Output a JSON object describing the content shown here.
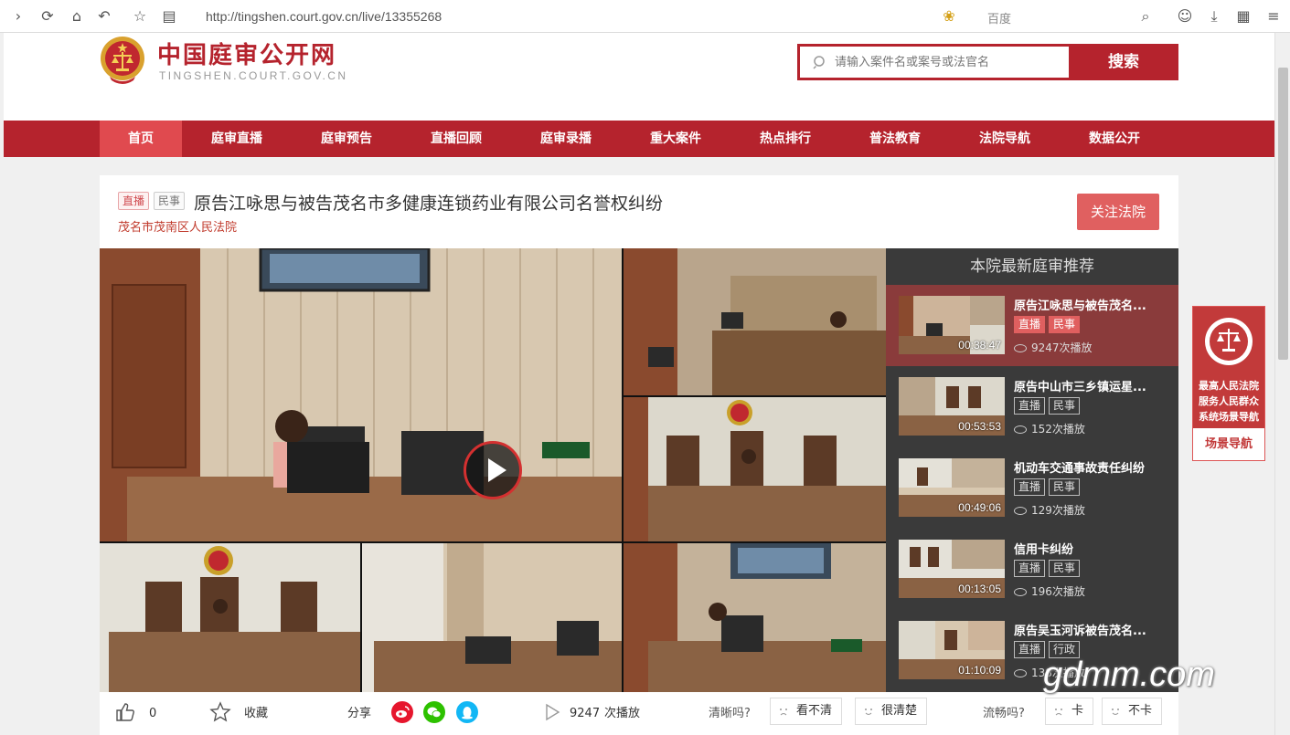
{
  "browser": {
    "url": "http://tingshen.court.gov.cn/live/13355268",
    "search_engine": "百度"
  },
  "site": {
    "title": "中国庭审公开网",
    "subtitle": "TINGSHEN.COURT.GOV.CN"
  },
  "search": {
    "placeholder": "请输入案件名或案号或法官名",
    "button": "搜索"
  },
  "nav": {
    "items": [
      "首页",
      "庭审直播",
      "庭审预告",
      "直播回顾",
      "庭审录播",
      "重大案件",
      "热点排行",
      "普法教育",
      "法院导航",
      "数据公开"
    ],
    "active_index": 0
  },
  "case": {
    "tag_live": "直播",
    "tag_type": "民事",
    "title": "原告江咏思与被告茂名市多健康连锁药业有限公司名誉权纠纷",
    "court": "茂名市茂南区人民法院",
    "follow_button": "关注法院"
  },
  "recommendations": {
    "title": "本院最新庭审推荐",
    "items": [
      {
        "name": "原告江咏思与被告茂名...",
        "duration": "00:38:47",
        "tags": [
          "直播",
          "民事"
        ],
        "views": "9247次播放"
      },
      {
        "name": "原告中山市三乡镇运星...",
        "duration": "00:53:53",
        "tags": [
          "直播",
          "民事"
        ],
        "views": "152次播放"
      },
      {
        "name": "机动车交通事故责任纠纷",
        "duration": "00:49:06",
        "tags": [
          "直播",
          "民事"
        ],
        "views": "129次播放"
      },
      {
        "name": "信用卡纠纷",
        "duration": "00:13:05",
        "tags": [
          "直播",
          "民事"
        ],
        "views": "196次播放"
      },
      {
        "name": "原告吴玉河诉被告茂名...",
        "duration": "01:10:09",
        "tags": [
          "直播",
          "行政"
        ],
        "views": "138次播放"
      }
    ]
  },
  "side_badge": {
    "line1": "最高人民法院",
    "line2": "服务人民群众",
    "line3": "系统场景导航",
    "button": "场景导航"
  },
  "bottom": {
    "likes": "0",
    "favorite": "收藏",
    "share": "分享",
    "plays": "9247",
    "plays_suffix": "次播放",
    "clarity_q": "清晰吗?",
    "unclear": "看不清",
    "clear": "很清楚",
    "smooth_q": "流畅吗?",
    "lag": "卡",
    "no_lag": "不卡"
  },
  "watermark": "gdmm.com",
  "colors": {
    "brand_red": "#b5232d",
    "nav_active": "#e04a4f",
    "follow": "#e06060"
  }
}
